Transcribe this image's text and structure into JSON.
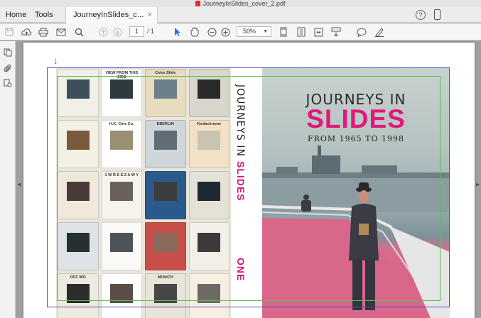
{
  "window": {
    "title": "JourneyInSlides_cover_2.pdf"
  },
  "tabs": {
    "home": "Home",
    "tools": "Tools",
    "document": "JourneyInSlides_c...",
    "close": "×"
  },
  "header": {
    "help": "?"
  },
  "toolbar": {
    "page_current": "1",
    "page_total": "/ 1",
    "zoom": "50%"
  },
  "icons": [
    "save-icon",
    "upload-icon",
    "print-icon",
    "email-icon",
    "search-icon",
    "page-up-icon",
    "page-down-icon",
    "select-arrow-icon",
    "hand-icon",
    "zoom-out-icon",
    "zoom-in-icon",
    "fit-page-icon",
    "scroll-icon",
    "fit-width-icon",
    "read-mode-icon",
    "comment-icon",
    "highlight-pen-icon",
    "thumbnails-icon",
    "attachments-icon",
    "tags-icon"
  ],
  "cover": {
    "back_slides": [
      {
        "label": ""
      },
      {
        "label": "VIEW FROM THIS SIDE"
      },
      {
        "label": "Color Slide"
      },
      {
        "label": ""
      },
      {
        "label": ""
      },
      {
        "label": "H.K. Cine Co."
      },
      {
        "label": "EBERLIN"
      },
      {
        "label": "Kodachrome"
      },
      {
        "label": ""
      },
      {
        "label": "1 W R E S Z A W Y"
      },
      {
        "label": ""
      },
      {
        "label": ""
      },
      {
        "label": ""
      },
      {
        "label": ""
      },
      {
        "label": ""
      },
      {
        "label": ""
      },
      {
        "label": "OFF WO"
      },
      {
        "label": ""
      },
      {
        "label": "MUNICH"
      },
      {
        "label": ""
      }
    ],
    "spine_title": "JOURNEYS IN",
    "spine_highlight": "SLIDES",
    "spine_volume": "ONE",
    "front_title_line1": "JOURNEYS IN",
    "front_title_line2": "SLIDES",
    "front_subtitle": "FROM 1965 TO 1998"
  },
  "colors": {
    "accent": "#e0197d",
    "trim_guide": "#4b4bcc",
    "bleed_guide": "#57c057",
    "toolbar_blue": "#2c6fd8"
  }
}
